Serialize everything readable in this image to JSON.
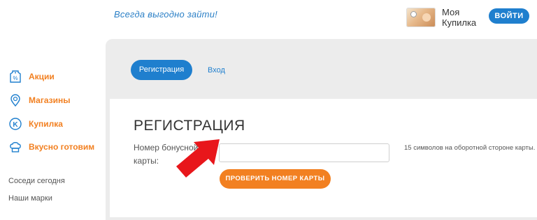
{
  "header": {
    "slogan": "Всегда выгодно зайти!",
    "account_label": "Моя Купилка",
    "login_label": "ВОЙТИ"
  },
  "sidebar": {
    "items": [
      {
        "label": "Акции",
        "icon": "tag-percent-icon"
      },
      {
        "label": "Магазины",
        "icon": "map-pin-icon"
      },
      {
        "label": "Купилка",
        "icon": "k-coin-icon"
      },
      {
        "label": "Вкусно готовим",
        "icon": "chef-hat-icon"
      }
    ],
    "footer_links": [
      "Соседи сегодня",
      "Наши марки"
    ]
  },
  "tabs": [
    {
      "label": "Регистрация",
      "active": true
    },
    {
      "label": "Вход",
      "active": false
    }
  ],
  "form": {
    "title": "РЕГИСТРАЦИЯ",
    "card_label": "Номер бонусной карты:",
    "card_value": "",
    "hint": "15 символов на оборотной стороне карты.",
    "submit_label": "ПРОВЕРИТЬ НОМЕР КАРТЫ"
  },
  "colors": {
    "brand_blue": "#1f7fce",
    "brand_orange": "#f28021",
    "annotation_arrow": "#e8161b"
  }
}
